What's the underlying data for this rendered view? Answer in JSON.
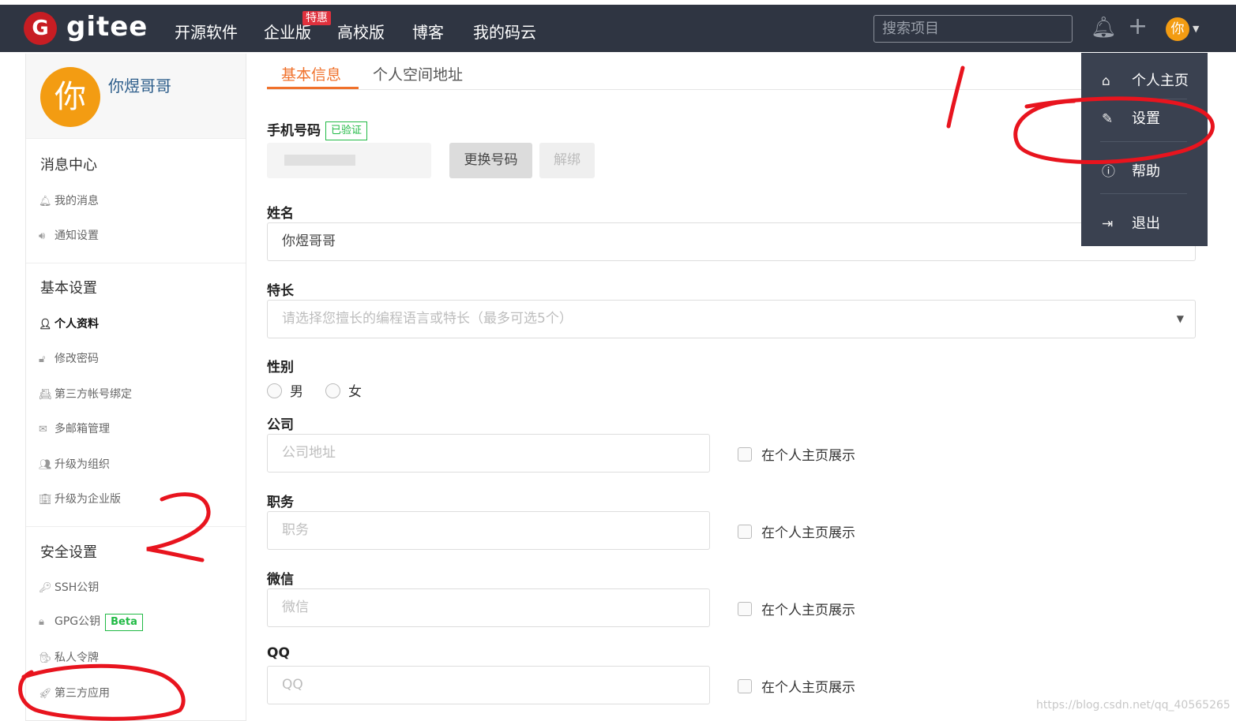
{
  "header": {
    "brand": "gitee",
    "logo_letter": "G",
    "nav": [
      "开源软件",
      "企业版",
      "高校版",
      "博客",
      "我的码云"
    ],
    "hot_badge": "特惠",
    "search_placeholder": "搜索项目",
    "avatar_char": "你"
  },
  "user_menu": {
    "items": [
      {
        "label": "个人主页",
        "icon": "home-icon"
      },
      {
        "label": "设置",
        "icon": "edit-icon"
      },
      {
        "label": "帮助",
        "icon": "help-icon"
      },
      {
        "label": "退出",
        "icon": "logout-icon"
      }
    ]
  },
  "sidebar": {
    "avatar_char": "你",
    "username": "你煜哥哥",
    "sections": [
      {
        "title": "消息中心",
        "items": [
          "我的消息",
          "通知设置"
        ]
      },
      {
        "title": "基本设置",
        "items": [
          "个人资料",
          "修改密码",
          "第三方帐号绑定",
          "多邮箱管理",
          "升级为组织",
          "升级为企业版"
        ]
      },
      {
        "title": "安全设置",
        "items": [
          "SSH公钥",
          "GPG公钥",
          "私人令牌",
          "第三方应用"
        ]
      }
    ],
    "beta_badge": "Beta",
    "active_item": "个人资料"
  },
  "main": {
    "tabs": [
      "基本信息",
      "个人空间地址"
    ],
    "phone_label": "手机号码",
    "verified_badge": "已验证",
    "change_phone_button": "更换号码",
    "unbind_button": "解绑",
    "name_label": "姓名",
    "name_value": "你煜哥哥",
    "skills_label": "特长",
    "skills_placeholder": "请选择您擅长的编程语言或特长（最多可选5个）",
    "gender_label": "性别",
    "gender_options": [
      "男",
      "女"
    ],
    "company_label": "公司",
    "company_placeholder": "公司地址",
    "position_label": "职务",
    "position_placeholder": "职务",
    "wechat_label": "微信",
    "wechat_placeholder": "微信",
    "qq_label": "QQ",
    "qq_placeholder": "QQ",
    "show_on_home": "在个人主页展示"
  },
  "annotations": {
    "one": "1",
    "two": "2"
  },
  "watermark": "https://blog.csdn.net/qq_40565265",
  "colors": {
    "topbar": "#2f3542",
    "accent": "#f0712b",
    "brand_red": "#c71d23",
    "avatar": "#f39c12",
    "verified_green": "#21ba45",
    "annotation_red": "#e8141e"
  }
}
